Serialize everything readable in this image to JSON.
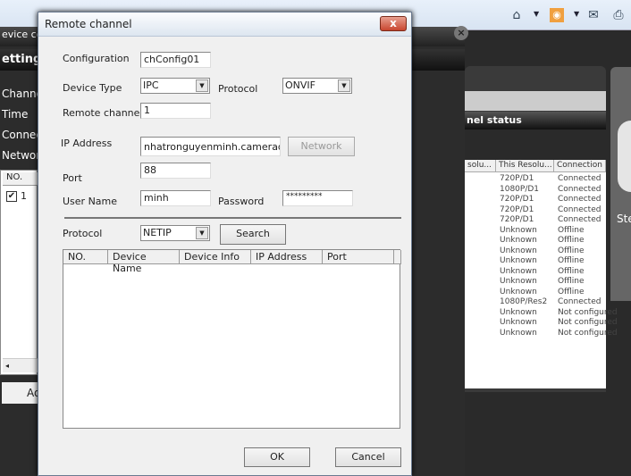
{
  "browser": {
    "icons": [
      "home-icon",
      "rss-icon",
      "mail-icon",
      "print-icon"
    ]
  },
  "background": {
    "window_title": "evice co",
    "section": "etting",
    "menu": [
      "Channel",
      "Time",
      "Connect",
      "Network"
    ],
    "list_header": "NO.",
    "list_item": "1",
    "add_button": "Ad",
    "status_title": "nel status",
    "side_text": "Ste",
    "status_columns": [
      "solu...",
      "This Resolu...",
      "Connection S"
    ],
    "status_rows": [
      [
        "720P/D1",
        "Connected"
      ],
      [
        "1080P/D1",
        "Connected"
      ],
      [
        "720P/D1",
        "Connected"
      ],
      [
        "720P/D1",
        "Connected"
      ],
      [
        "720P/D1",
        "Connected"
      ],
      [
        "Unknown",
        "Offline"
      ],
      [
        "Unknown",
        "Offline"
      ],
      [
        "Unknown",
        "Offline"
      ],
      [
        "Unknown",
        "Offline"
      ],
      [
        "Unknown",
        "Offline"
      ],
      [
        "Unknown",
        "Offline"
      ],
      [
        "Unknown",
        "Offline"
      ],
      [
        "1080P/Res2",
        "Connected"
      ],
      [
        "Unknown",
        "Not configured"
      ],
      [
        "Unknown",
        "Not configured"
      ],
      [
        "Unknown",
        "Not configured"
      ]
    ]
  },
  "dialog": {
    "title": "Remote channel",
    "close": "x",
    "configuration_label": "Configuration",
    "configuration_value": "chConfig01",
    "device_type_label": "Device Type",
    "device_type_value": "IPC",
    "protocol_label": "Protocol",
    "protocol_value": "ONVIF",
    "remote_channel_label": "Remote channel",
    "remote_channel_value": "1",
    "ip_label": "IP Address",
    "ip_value": "nhatronguyenminh.cameraddns",
    "network_button": "Network",
    "port_label": "Port",
    "port_value": "88",
    "user_label": "User Name",
    "user_value": "minh",
    "password_label": "Password",
    "password_value": "*********",
    "search_protocol_label": "Protocol",
    "search_protocol_value": "NETIP",
    "search_button": "Search",
    "columns": [
      "NO.",
      "Device Name",
      "Device Info",
      "IP Address",
      "Port"
    ],
    "ok": "OK",
    "cancel": "Cancel"
  }
}
